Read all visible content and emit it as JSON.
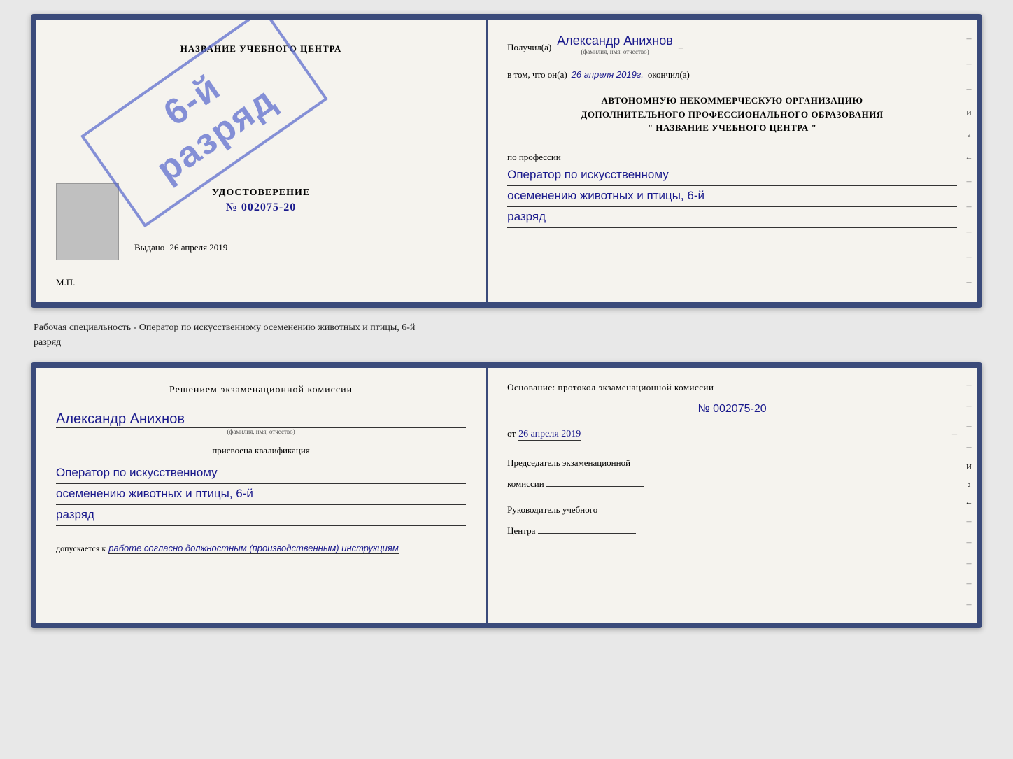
{
  "top_doc": {
    "left": {
      "center_title": "НАЗВАНИЕ УЧЕБНОГО ЦЕНТРА",
      "cert_label": "УДОСТОВЕРЕНИЕ",
      "cert_number": "№ 002075-20",
      "stamp_line1": "6-й",
      "stamp_line2": "разряд",
      "issued_label": "Выдано",
      "issued_date": "26 апреля 2019",
      "mp_label": "М.П."
    },
    "right": {
      "received_label": "Получил(а)",
      "recipient_name": "Александр Анихнов",
      "name_sublabel": "(фамилия, имя, отчество)",
      "in_that_label": "в том, что он(а)",
      "completion_date": "26 апреля 2019г.",
      "completed_label": "окончил(а)",
      "org_line1": "АВТОНОМНУЮ НЕКОММЕРЧЕСКУЮ ОРГАНИЗАЦИЮ",
      "org_line2": "ДОПОЛНИТЕЛЬНОГО ПРОФЕССИОНАЛЬНОГО ОБРАЗОВАНИЯ",
      "org_line3": "\"  НАЗВАНИЕ УЧЕБНОГО ЦЕНТРА  \"",
      "profession_label": "по профессии",
      "profession_line1": "Оператор по искусственному",
      "profession_line2": "осеменению животных и птицы, 6-й",
      "profession_line3": "разряд",
      "side_marks": [
        "-",
        "-",
        "-",
        "И",
        "а",
        "←",
        "-",
        "-",
        "-",
        "-",
        "-"
      ]
    }
  },
  "middle_text": "Рабочая специальность - Оператор по искусственному осеменению животных и птицы, 6-й\nразряд",
  "bottom_doc": {
    "left": {
      "decision_title": "Решением экзаменационной комиссии",
      "person_name": "Александр Анихнов",
      "name_sublabel": "(фамилия, имя, отчество)",
      "assigned_label": "присвоена квалификация",
      "qualification_line1": "Оператор по искусственному",
      "qualification_line2": "осеменению животных и птицы, 6-й",
      "qualification_line3": "разряд",
      "allowed_label": "допускается к",
      "allowed_value": "работе согласно должностным (производственным) инструкциям"
    },
    "right": {
      "basis_title": "Основание: протокол экзаменационной комиссии",
      "protocol_number": "№  002075-20",
      "date_prefix": "от",
      "protocol_date": "26 апреля 2019",
      "chairman_label": "Председатель экзаменационной\nкомиссии",
      "director_label": "Руководитель учебного\nЦентра",
      "side_marks": [
        "-",
        "-",
        "-",
        "-",
        "И",
        "а",
        "←",
        "-",
        "-",
        "-",
        "-",
        "-"
      ]
    }
  }
}
